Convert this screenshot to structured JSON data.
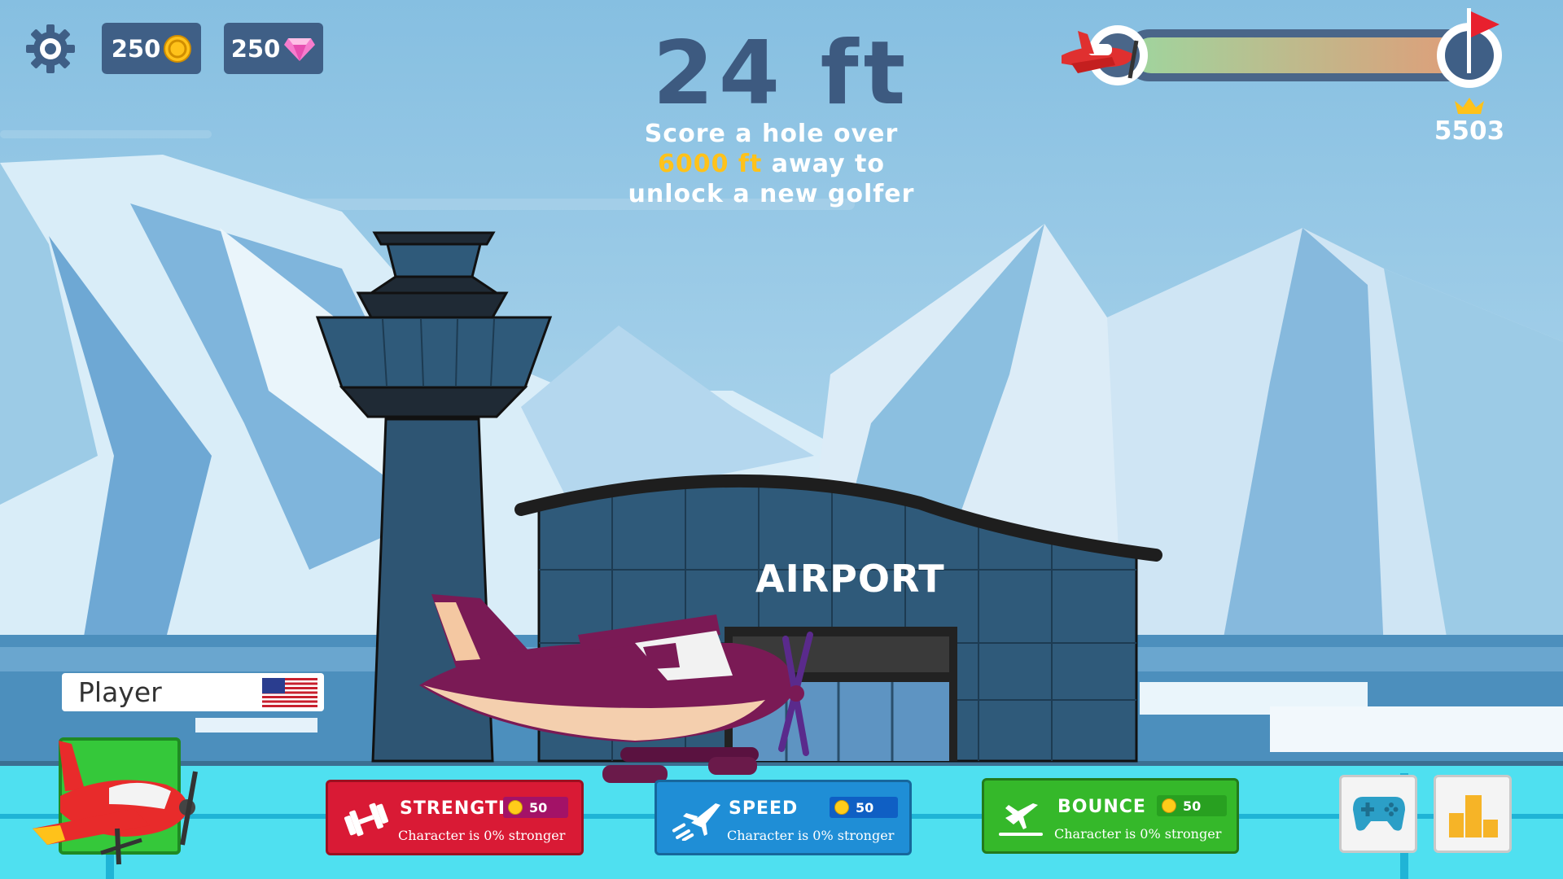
{
  "hud": {
    "coins": "250",
    "gems": "250",
    "distance": "24 ft",
    "hint_before": "Score a hole over ",
    "hint_highlight": "6000 ft",
    "hint_after": " away to unlock a new golfer",
    "record": "5503",
    "progress": 0.03
  },
  "scene": {
    "airport_sign": "AIRPORT"
  },
  "player": {
    "name": "Player",
    "flag": "us-flag-icon"
  },
  "upgrades": [
    {
      "name": "STRENGTH",
      "price": "50",
      "description": "Character is 0% stronger",
      "color": "#d91a35",
      "icon": "dumbbell-icon"
    },
    {
      "name": "SPEED",
      "price": "50",
      "description": "Character is 0% stronger",
      "color": "#1f8ed6",
      "icon": "plane-speed-icon"
    },
    {
      "name": "BOUNCE",
      "price": "50",
      "description": "Character is 0% stronger",
      "color": "#35b82a",
      "icon": "plane-landing-icon"
    }
  ],
  "buttons": {
    "game_mode": "gamepad-icon",
    "leaderboard": "podium-icon",
    "settings": "gear-icon"
  },
  "colors": {
    "hud_panel": "#3f5f86",
    "distance_text": "#3d5a80",
    "highlight": "#ffc21a"
  }
}
